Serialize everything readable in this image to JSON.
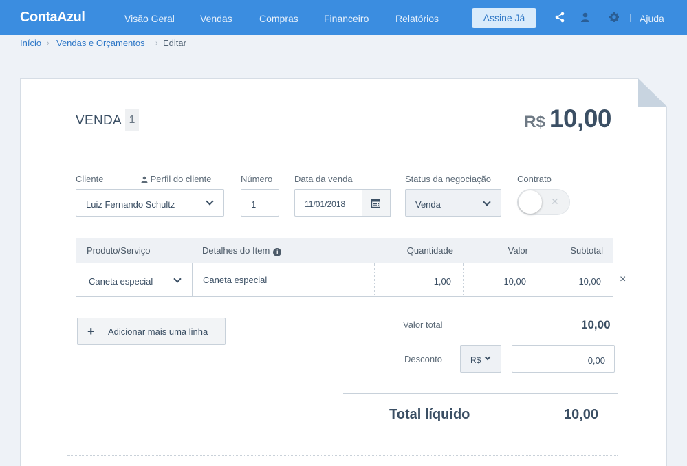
{
  "app": {
    "name": "ContaAzul"
  },
  "nav": {
    "items": [
      "Visão Geral",
      "Vendas",
      "Compras",
      "Financeiro",
      "Relatórios"
    ],
    "cta_label": "Assine Já",
    "help_label": "Ajuda"
  },
  "breadcrumb": {
    "items": [
      "Início",
      "Vendas e Orçamentos"
    ],
    "current": "Editar"
  },
  "header": {
    "title": "VENDA",
    "number": "1",
    "currency": "R$",
    "total": "10,00"
  },
  "form": {
    "cliente_label": "Cliente",
    "perfil_label": "Perfil do cliente",
    "cliente_value": "Luiz Fernando Schultz",
    "numero_label": "Número",
    "numero_value": "1",
    "data_label": "Data da venda",
    "data_value": "11/01/2018",
    "status_label": "Status da negociação",
    "status_value": "Venda",
    "contrato_label": "Contrato",
    "contrato_on": false
  },
  "table": {
    "columns": [
      "Produto/Serviço",
      "Detalhes do Item",
      "Quantidade",
      "Valor",
      "Subtotal"
    ],
    "rows": [
      {
        "produto": "Caneta especial",
        "detalhes": "Caneta especial",
        "quantidade": "1,00",
        "valor": "10,00",
        "subtotal": "10,00"
      }
    ]
  },
  "add_line_label": "Adicionar mais uma linha",
  "summary": {
    "valor_total_label": "Valor total",
    "valor_total": "10,00",
    "desconto_label": "Desconto",
    "desconto_currency": "R$",
    "desconto_value": "0,00",
    "liquido_label": "Total líquido",
    "liquido_value": "10,00"
  },
  "colors": {
    "brand": "#3b8de0",
    "text": "#3b4f64",
    "link": "#2f78c7"
  }
}
